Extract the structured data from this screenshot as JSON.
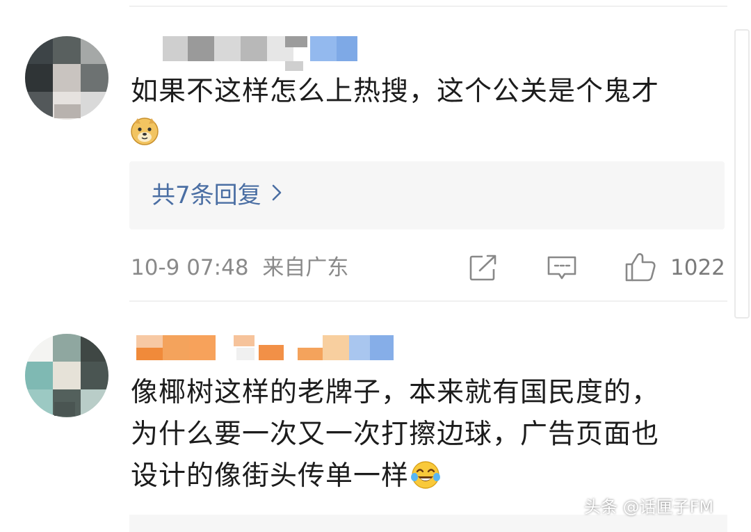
{
  "comments": [
    {
      "text_lines": [
        "如果不这样怎么上热搜，这个公关是个鬼才"
      ],
      "emoji": "doge-emoji",
      "replies_label": "共7条回复",
      "time": "10-9 07:48",
      "location": "来自广东",
      "like_count": "1022",
      "icons": [
        "share-icon",
        "comment-icon",
        "thumbs-up-icon"
      ]
    },
    {
      "text_lines": [
        "像椰树这样的老牌子，本来就有国民度的，",
        "为什么要一次又一次打擦边球，广告页面也",
        "设计的像街头传单一样"
      ],
      "emoji": "laughing-tears-emoji"
    }
  ],
  "watermark": "头条 @话匣子FM",
  "colors": {
    "link": "#4a6ea3",
    "meta": "#8a8a8a",
    "reply_bg": "#f6f6f6"
  }
}
